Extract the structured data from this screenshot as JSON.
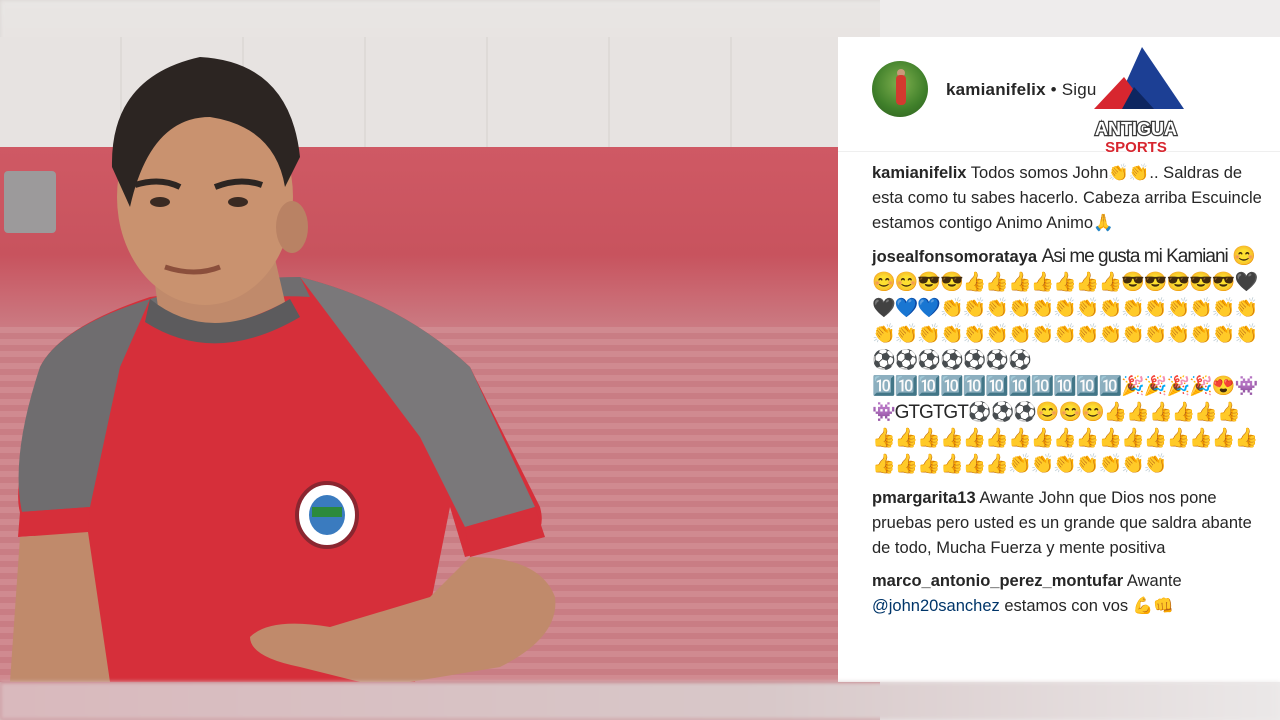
{
  "post": {
    "username": "kamianifelix",
    "follow_label": "• Sigu"
  },
  "logo": {
    "line1": "ANTIGUA",
    "line2": "SPORTS"
  },
  "comments": [
    {
      "user": "kamianifelix",
      "text": "Todos somos John👏👏.. Saldras de esta como tu sabes hacerlo. Cabeza arriba Escuincle estamos contigo Animo Animo🙏"
    },
    {
      "user": "josealfonsomorataya",
      "text": "Asi me gusta mi Kamiani 😊😊😊😎😎👍👍👍👍👍👍👍😎😎😎😎😎🖤🖤💙💙👏👏👏👏👏👏👏👏👏👏👏👏👏👏👏👏👏👏👏👏👏👏👏👏👏👏👏👏👏👏👏⚽⚽⚽⚽⚽⚽⚽🔟🔟🔟🔟🔟🔟🔟🔟🔟🔟🔟🎉🎉🎉🎉😍👾👾GTGTGT⚽⚽⚽😊😊😊👍👍👍👍👍👍👍👍👍👍👍👍👍👍👍👍👍👍👍👍👍👍👍👍👍👍👍👍👍👏👏👏👏👏👏👏"
    },
    {
      "user": "pmargarita13",
      "text": "Awante John que Dios nos pone pruebas pero usted es un grande que saldra abante de todo, Mucha Fuerza y mente positiva"
    },
    {
      "user": "marco_antonio_perez_montufar",
      "text": "Awante",
      "mention": "@john20sanchez",
      "text2": "estamos con vos 💪👊"
    }
  ],
  "colors": {
    "jersey": "#d62f3a",
    "sleeve": "#6b6a6c",
    "logo_red": "#d7262f",
    "logo_blue": "#1c3f94"
  }
}
